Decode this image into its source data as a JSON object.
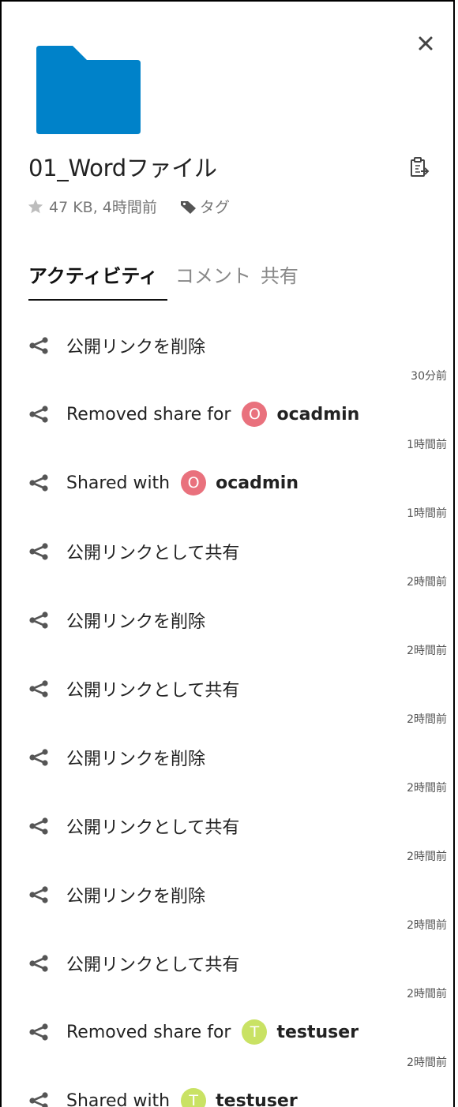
{
  "file": {
    "name": "01_Wordファイル",
    "meta": "47 KB, 4時間前",
    "tags_label": "タグ",
    "folder_color": "#0082c9"
  },
  "tabs": [
    {
      "label": "アクティビティ",
      "active": true
    },
    {
      "label": "コメント",
      "active": false
    },
    {
      "label": "共有",
      "active": false
    }
  ],
  "activities": [
    {
      "text": "公開リンクを削除",
      "time": "30分前"
    },
    {
      "text": "Removed share for",
      "user": "ocadmin",
      "avatar_letter": "O",
      "avatar_color": "#e9717d",
      "time": "1時間前"
    },
    {
      "text": "Shared with",
      "user": "ocadmin",
      "avatar_letter": "O",
      "avatar_color": "#e9717d",
      "time": "1時間前"
    },
    {
      "text": "公開リンクとして共有",
      "time": "2時間前"
    },
    {
      "text": "公開リンクを削除",
      "time": "2時間前"
    },
    {
      "text": "公開リンクとして共有",
      "time": "2時間前"
    },
    {
      "text": "公開リンクを削除",
      "time": "2時間前"
    },
    {
      "text": "公開リンクとして共有",
      "time": "2時間前"
    },
    {
      "text": "公開リンクを削除",
      "time": "2時間前"
    },
    {
      "text": "公開リンクとして共有",
      "time": "2時間前"
    },
    {
      "text": "Removed share for",
      "user": "testuser",
      "avatar_letter": "T",
      "avatar_color": "#c9e264",
      "time": "2時間前"
    },
    {
      "text": "Shared with",
      "user": "testuser",
      "avatar_letter": "T",
      "avatar_color": "#c9e264",
      "time": ""
    }
  ]
}
